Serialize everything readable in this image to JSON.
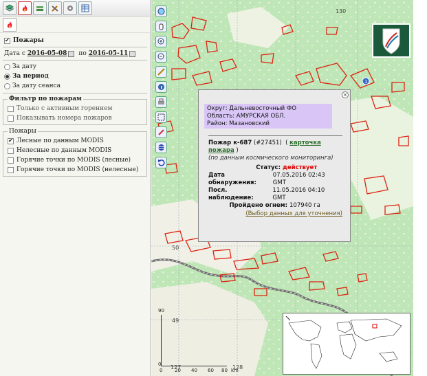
{
  "toolbar": {
    "tabs": [
      "layers",
      "fire",
      "forest",
      "tools",
      "settings",
      "table"
    ],
    "active": "fire"
  },
  "fires_panel": {
    "section_title": "Пожары",
    "date_from_label": "Дата с",
    "date_from": "2016-05-08",
    "date_to_label": "по",
    "date_to": "2016-05-11",
    "radio_by_date": "За дату",
    "radio_by_period": "За период",
    "radio_by_session": "За дату сеанса",
    "filter_title": "Фильтр по пожарам",
    "filter_active_only": "Только с активным горением",
    "filter_show_numbers": "Показывать номера пожаров",
    "fires_group": "Пожары",
    "layer_forest": "Лесные по данным MODIS",
    "layer_nonforest": "Нелесные по данным MODIS",
    "layer_hot_forest": "Горячие точки по MODIS (лесные)",
    "layer_hot_nonforest": "Горячие точки по MODIS (нелесные)"
  },
  "map": {
    "grid_labels": {
      "lon_130": "130",
      "lat_50": "50",
      "lat_49": "49",
      "lon_127": "127",
      "lon_128": "128"
    },
    "scale": {
      "ticks": [
        "0",
        "20",
        "40",
        "60",
        "80"
      ],
      "unit": "km",
      "vtop": "90",
      "v": "0"
    }
  },
  "popup": {
    "okrug": "Округ: Дальневосточный ФО",
    "oblast": "Область: АМУРСКАЯ ОБЛ.",
    "rayon": "Район: Мазановский",
    "fire_title": "Пожар к-687",
    "fire_id": "(#27451)",
    "card_link": "карточка пожара",
    "source_note": "(по данным космического мониторинга)",
    "status_label": "Статус:",
    "status_value": "действует",
    "detected_label": "Дата обнаружения:",
    "detected_value": "07.05.2016 02:43 GMT",
    "last_obs_label": "Посл. наблюдение:",
    "last_obs_value": "11.05.2016 04:10 GMT",
    "burned_label": "Пройдено огнем:",
    "burned_value": "107940 га",
    "refine_link": "(Выбор данных для уточнения)"
  }
}
